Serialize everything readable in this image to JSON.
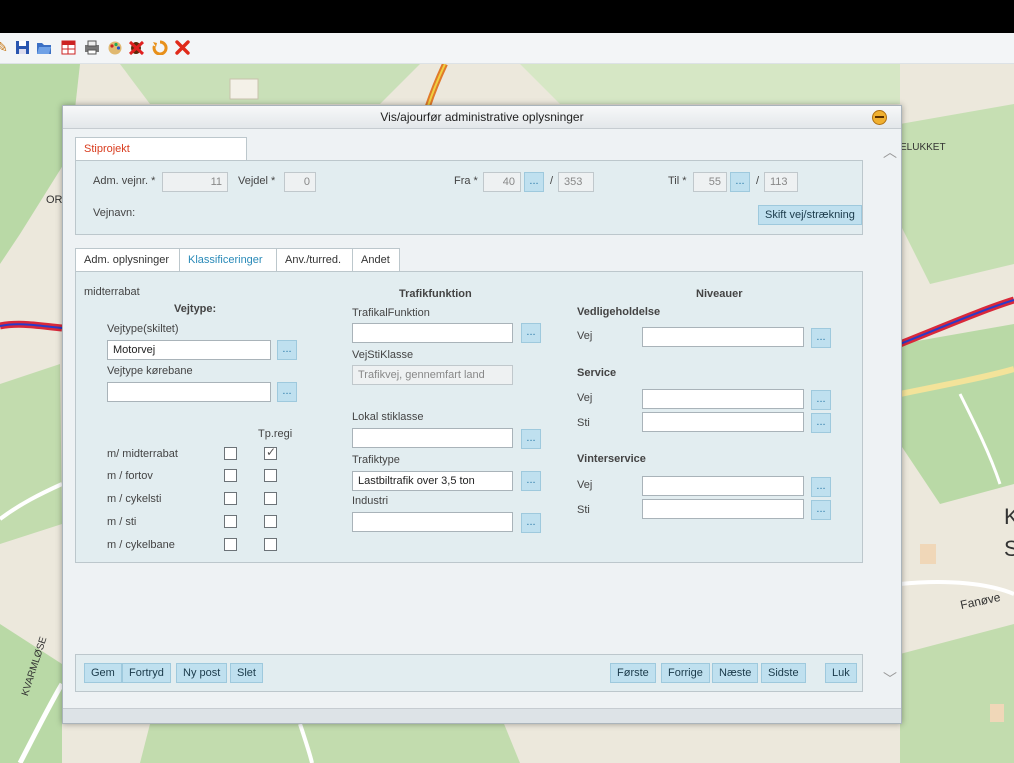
{
  "dialog": {
    "title": "Vis/ajourfør administrative oplysninger"
  },
  "top_tab": "Stiprojekt",
  "header": {
    "adm_vejnr_label": "Adm. vejnr. *",
    "adm_vejnr": "11",
    "vejdel_label": "Vejdel *",
    "vejdel": "0",
    "fra_label": "Fra *",
    "fra": "40",
    "fra_total": "353",
    "til_label": "Til *",
    "til": "55",
    "til_total": "113",
    "slash": "/",
    "dots": "...",
    "vejnavn_label": "Vejnavn:",
    "skift_button": "Skift vej/strækning"
  },
  "tabs": [
    "Adm. oplysninger",
    "Klassificeringer",
    "Anv./turred.",
    "Andet"
  ],
  "klass": {
    "corner_label": "midterrabat",
    "vejtype_header": "Vejtype:",
    "vejtype_skiltet_label": "Vejtype(skiltet)",
    "vejtype_skiltet_value": "Motorvej",
    "vejtype_korebane_label": "Vejtype kørebane",
    "vejtype_korebane_value": "",
    "tp_regi_label": "Tp.regi",
    "checks": [
      {
        "label": "m/ midterrabat",
        "c1": false,
        "c2": true
      },
      {
        "label": "m / fortov",
        "c1": false,
        "c2": false
      },
      {
        "label": "m / cykelsti",
        "c1": false,
        "c2": false
      },
      {
        "label": "m / sti",
        "c1": false,
        "c2": false
      },
      {
        "label": "m / cykelbane",
        "c1": false,
        "c2": false
      }
    ],
    "trafikfunktion_header": "Trafikfunktion",
    "trafikalfunktion_label": "TrafikalFunktion",
    "trafikalfunktion_value": "",
    "vejstiklasse_label": "VejStiKlasse",
    "vejstiklasse_value": "Trafikvej, gennemfart land",
    "lokal_stiklasse_label": "Lokal stiklasse",
    "lokal_stiklasse_value": "",
    "trafiktype_label": "Trafiktype",
    "trafiktype_value": "Lastbiltrafik over 3,5 ton",
    "industri_label": "Industri",
    "industri_value": "",
    "niveauer_header": "Niveauer",
    "vedligeholdelse_header": "Vedligeholdelse",
    "service_header": "Service",
    "vinterservice_header": "Vinterservice",
    "vej_label": "Vej",
    "sti_label": "Sti"
  },
  "footer": {
    "left": [
      "Gem",
      "Fortryd",
      "Ny post",
      "Slet"
    ],
    "right": [
      "Første",
      "Forrige",
      "Næste",
      "Sidste"
    ],
    "close": "Luk"
  },
  "map_labels": {
    "delukket": "ELUKKET",
    "or": "OR",
    "k": "K",
    "s": "S",
    "fanove": "Fanøve",
    "kvarmlose": "KVARMLØSE"
  },
  "colors": {
    "accent": "#2a8ab8",
    "button_bg": "#bfe0ef",
    "road_red": "#d9283a",
    "road_blue": "#2a3cc8"
  }
}
